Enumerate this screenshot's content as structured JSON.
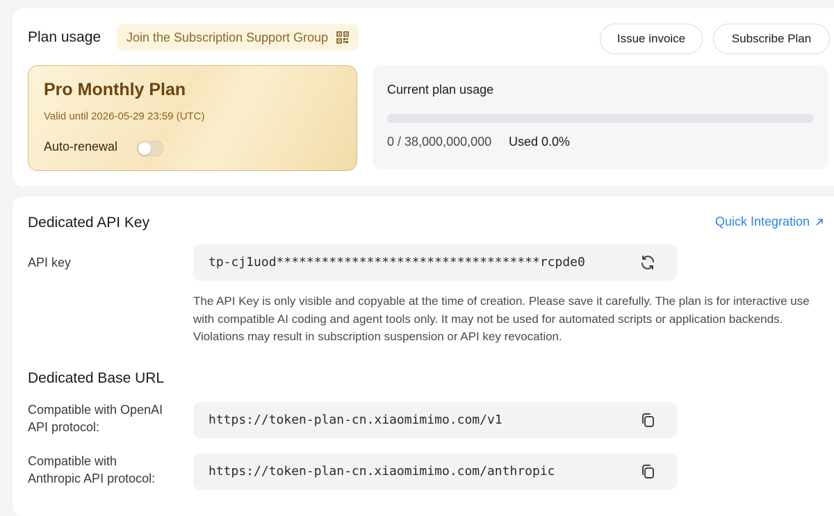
{
  "plan_section": {
    "title": "Plan usage",
    "support_group_label": "Join the Subscription Support Group",
    "issue_invoice_label": "Issue invoice",
    "subscribe_plan_label": "Subscribe Plan"
  },
  "plan_card": {
    "name": "Pro Monthly Plan",
    "valid_until": "Valid until 2026-05-29 23:59 (UTC)",
    "auto_renewal_label": "Auto-renewal",
    "auto_renewal_on": false
  },
  "usage": {
    "title": "Current plan usage",
    "count": "0 / 38,000,000,000",
    "used": "Used 0.0%",
    "progress_fraction": 0.0
  },
  "api_section": {
    "title": "Dedicated API Key",
    "quick_integration_label": "Quick Integration",
    "api_key_label": "API key",
    "api_key_value": "tp-cj1uod***********************************rcpde0",
    "description": "The API Key is only visible and copyable at the time of creation. Please save it carefully. The plan is for interactive use with compatible AI coding and agent tools only. It may not be used for automated scripts or application backends. Violations may result in subscription suspension or API key revocation."
  },
  "base_url_section": {
    "title": "Dedicated Base URL",
    "openai_label_line1": "Compatible with OpenAI",
    "openai_label_line2": "API protocol:",
    "openai_url": "https://token-plan-cn.xiaomimimo.com/v1",
    "anthropic_label_line1": "Compatible with",
    "anthropic_label_line2": "Anthropic API protocol:",
    "anthropic_url": "https://token-plan-cn.xiaomimimo.com/anthropic"
  },
  "icons": {
    "qr": "qr-code-icon",
    "refresh": "refresh-icon",
    "copy": "copy-icon",
    "external": "arrow-up-right-icon"
  },
  "colors": {
    "accent_link": "#2b84e6",
    "plan_gold": "#6a4512",
    "pill_bg": "#fcf4df"
  }
}
